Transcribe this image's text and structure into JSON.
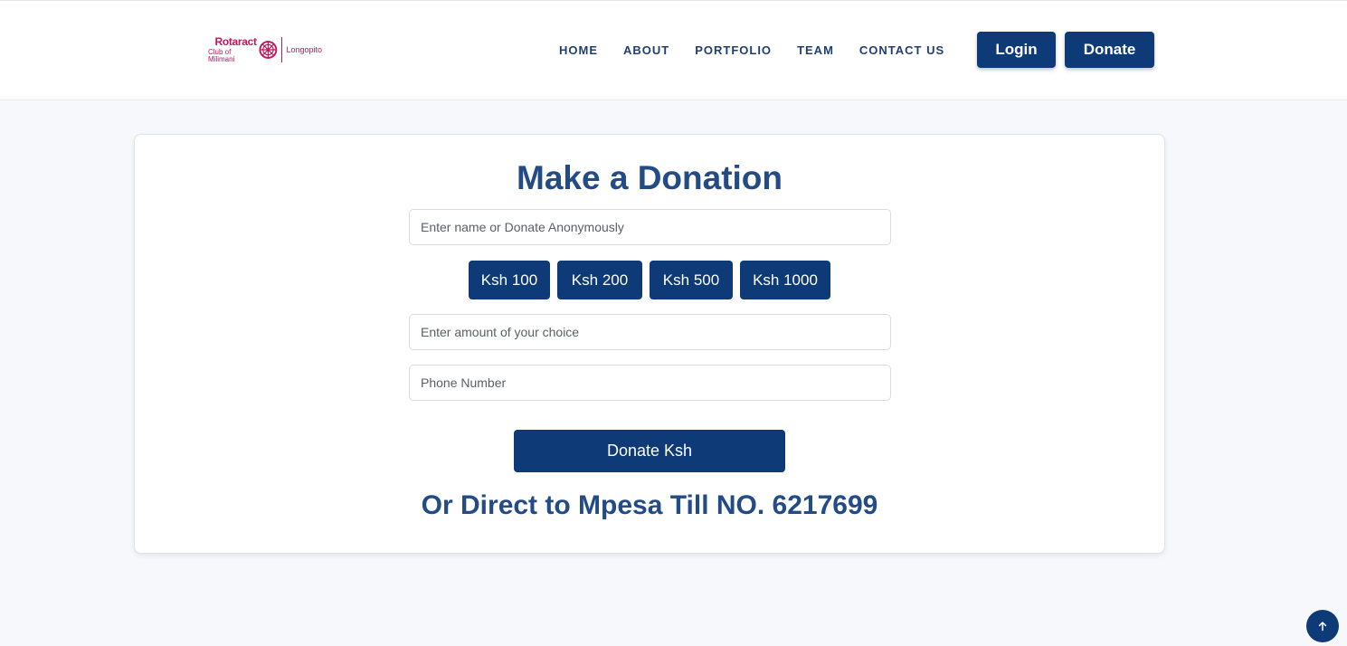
{
  "brand": {
    "name": "Rotaract",
    "subtitle": "Club of Milimani",
    "club": "Longopito",
    "accent_color": "#c1185b"
  },
  "nav": {
    "items": [
      {
        "label": "HOME"
      },
      {
        "label": "ABOUT"
      },
      {
        "label": "PORTFOLIO"
      },
      {
        "label": "TEAM"
      },
      {
        "label": "CONTACT US"
      }
    ],
    "login_label": "Login",
    "donate_label": "Donate"
  },
  "donation": {
    "title": "Make a Donation",
    "name_placeholder": "Enter name or Donate Anonymously",
    "amounts": [
      {
        "label": "Ksh 100"
      },
      {
        "label": "Ksh 200"
      },
      {
        "label": "Ksh 500"
      },
      {
        "label": "Ksh 1000"
      }
    ],
    "amount_placeholder": "Enter amount of your choice",
    "phone_placeholder": "Phone Number",
    "submit_label": "Donate Ksh",
    "mpesa_text": "Or Direct to Mpesa Till NO. 6217699"
  },
  "icons": {
    "logo": "rotary-wheel-icon",
    "scroll_top": "arrow-up-icon"
  },
  "colors": {
    "primary": "#0e3a78",
    "heading": "#234b85",
    "background": "#f6f8fb"
  }
}
